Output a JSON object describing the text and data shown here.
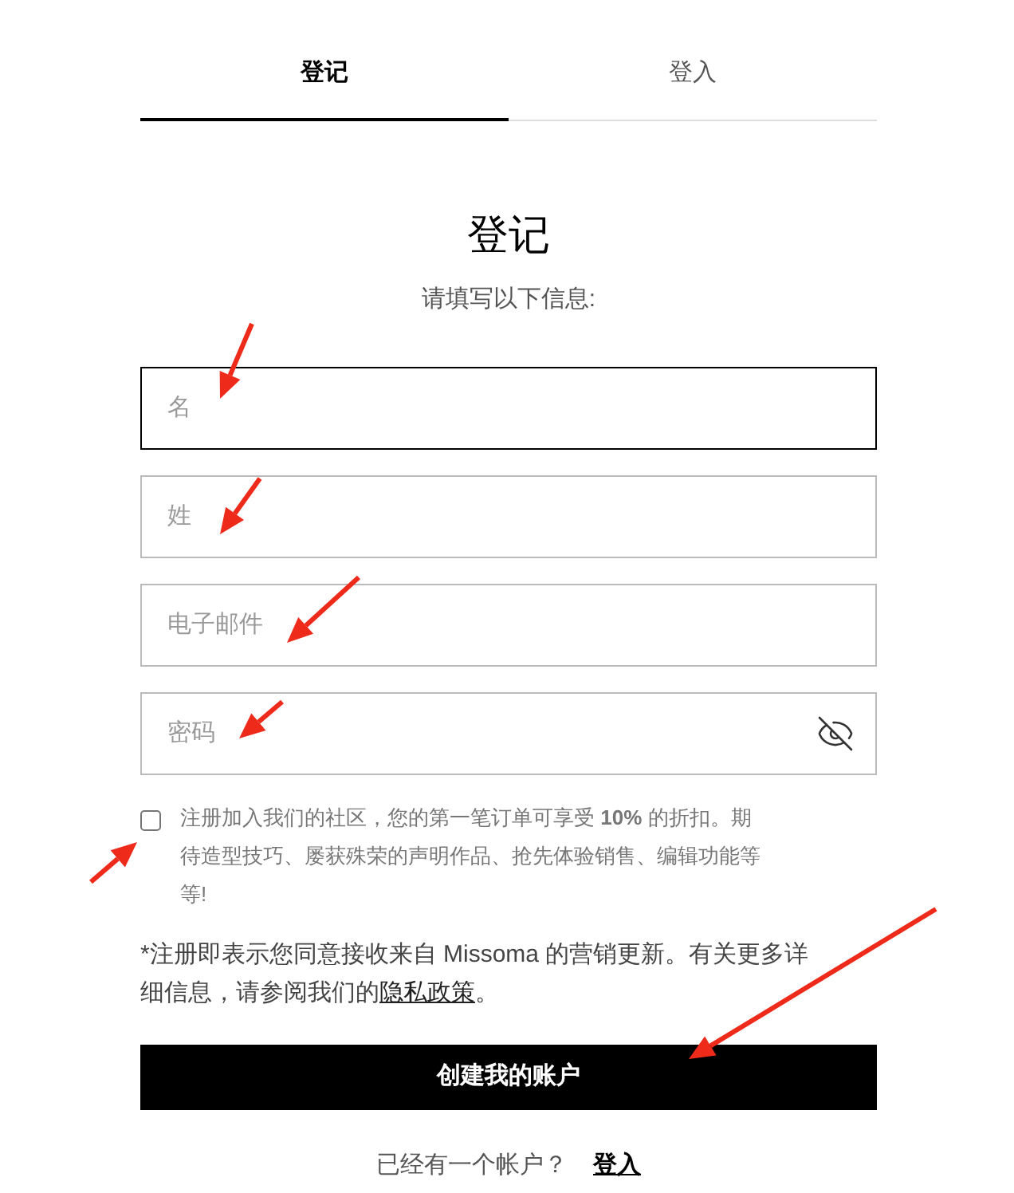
{
  "tabs": [
    {
      "label": "登记",
      "selected": true
    },
    {
      "label": "登入",
      "selected": false
    }
  ],
  "heading": "登记",
  "subtitle": "请填写以下信息:",
  "fields": [
    {
      "kind": "text",
      "placeholder": "名",
      "focused": true
    },
    {
      "kind": "text",
      "placeholder": "姓",
      "focused": false
    },
    {
      "kind": "text",
      "placeholder": "电子邮件",
      "focused": false
    },
    {
      "kind": "password",
      "placeholder": "密码",
      "focused": false
    }
  ],
  "newsletter": {
    "checked": false,
    "text": "注册加入我们的社区，您的第一笔订单可享受 **10%** 的折扣。期待造型技巧、屡获殊荣的声明作品、抢先体验销售、编辑功能等等!"
  },
  "disclaimer": {
    "text": "*注册即表示您同意接收来自 Missoma 的营销更新。有关更多详细信息，请参阅我们的",
    "link": "隐私政策",
    "end": "。"
  },
  "submit": "创建我的账户",
  "footer": {
    "prompt": "已经有一个帐户？",
    "link": "登入"
  }
}
